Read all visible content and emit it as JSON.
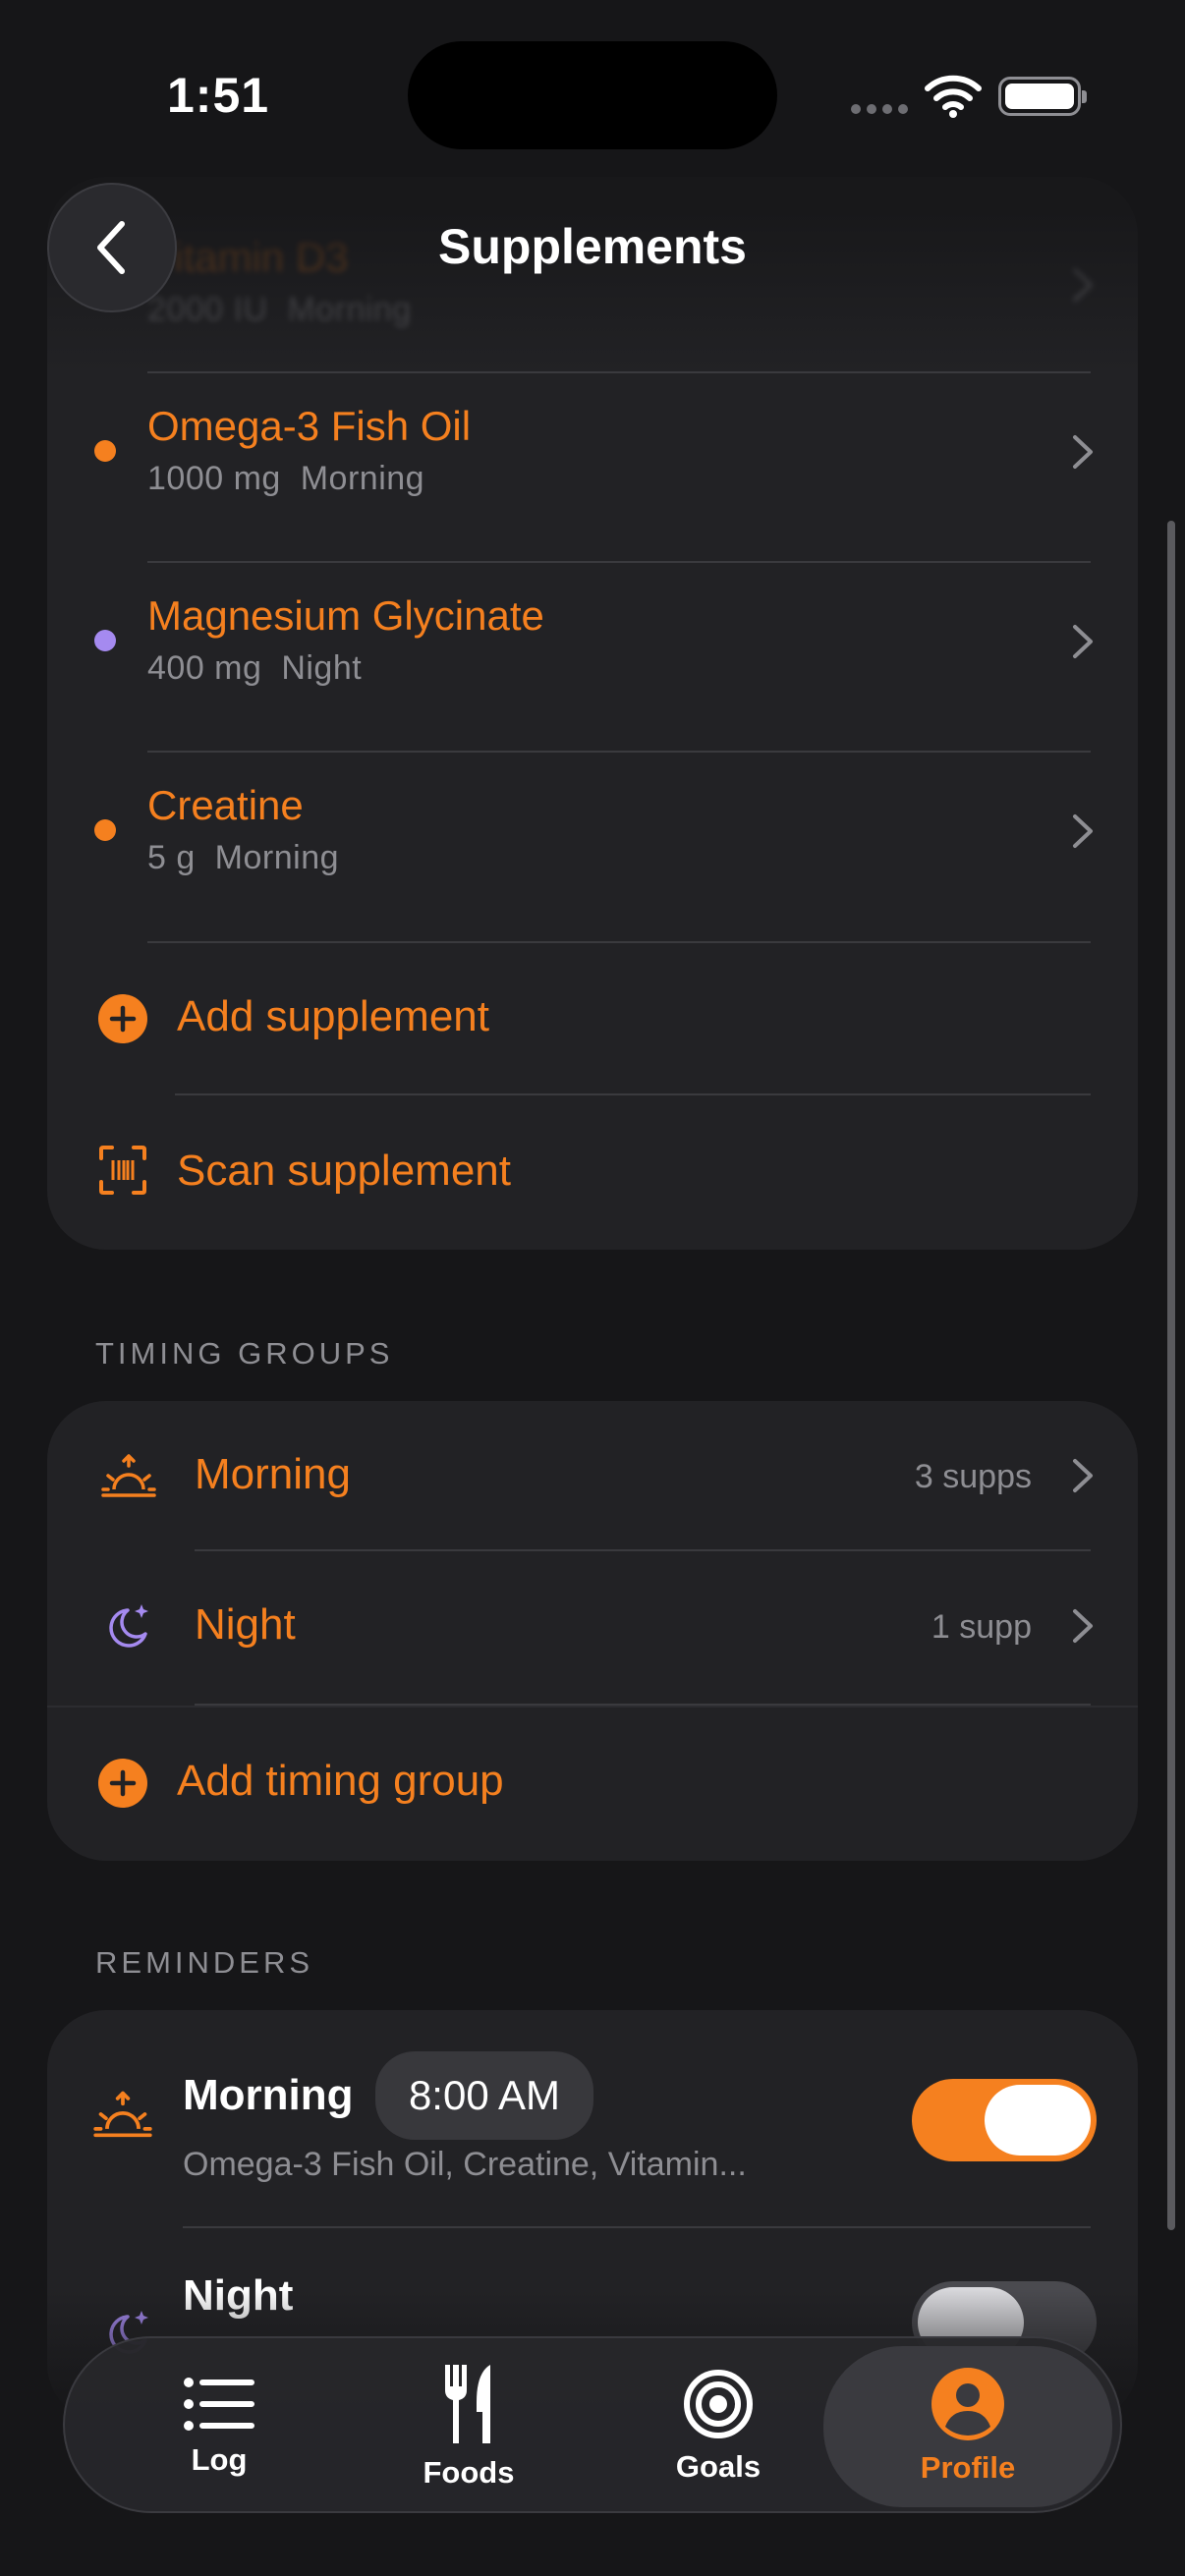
{
  "status": {
    "time": "1:51"
  },
  "nav": {
    "title": "Supplements",
    "back_icon": "chevron-left-icon"
  },
  "supplements": {
    "items": [
      {
        "name": "Vitamin D3",
        "dose": "2000 IU",
        "timing": "Morning",
        "color": "#f5801f"
      },
      {
        "name": "Omega-3 Fish Oil",
        "dose": "1000 mg",
        "timing": "Morning",
        "color": "#f5801f"
      },
      {
        "name": "Magnesium Glycinate",
        "dose": "400 mg",
        "timing": "Night",
        "color": "#a58af0"
      },
      {
        "name": "Creatine",
        "dose": "5 g",
        "timing": "Morning",
        "color": "#f5801f"
      }
    ],
    "add_label": "Add supplement",
    "scan_label": "Scan supplement"
  },
  "timing_groups": {
    "header": "TIMING GROUPS",
    "items": [
      {
        "name": "Morning",
        "count": "3 supps",
        "icon": "sunrise-icon"
      },
      {
        "name": "Night",
        "count": "1 supp",
        "icon": "moon-stars-icon"
      }
    ],
    "add_label": "Add timing group"
  },
  "reminders": {
    "header": "REMINDERS",
    "items": [
      {
        "name": "Morning",
        "time": "8:00 AM",
        "supplements": "Omega-3 Fish Oil, Creatine, Vitamin...",
        "enabled": true
      },
      {
        "name": "Night",
        "enabled": false
      }
    ]
  },
  "tabs": [
    {
      "label": "Log",
      "icon": "list-icon",
      "active": false
    },
    {
      "label": "Foods",
      "icon": "fork-knife-icon",
      "active": false
    },
    {
      "label": "Goals",
      "icon": "target-icon",
      "active": false
    },
    {
      "label": "Profile",
      "icon": "person-circle-icon",
      "active": true
    }
  ],
  "colors": {
    "accent": "#f5801f",
    "night": "#a58af0",
    "background": "#161618",
    "card": "#222225"
  }
}
